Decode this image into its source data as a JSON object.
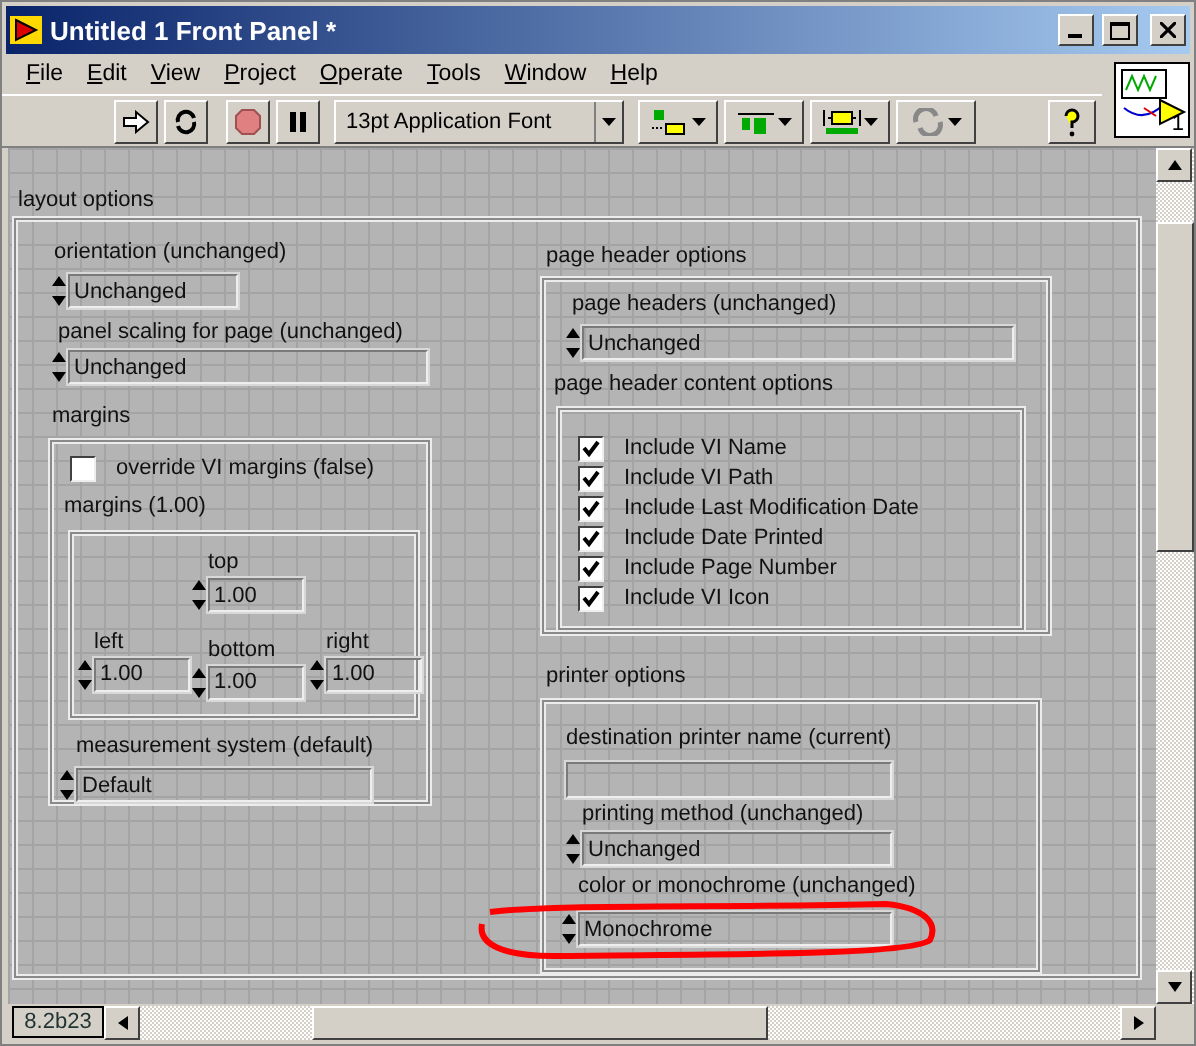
{
  "window": {
    "title": "Untitled 1 Front Panel *"
  },
  "menu": [
    "File",
    "Edit",
    "View",
    "Project",
    "Operate",
    "Tools",
    "Window",
    "Help"
  ],
  "toolbar": {
    "font": "13pt Application Font"
  },
  "vi_icon": {
    "number": "1"
  },
  "panel": {
    "label": "layout options",
    "orientation": {
      "label": "orientation (unchanged)",
      "value": "Unchanged"
    },
    "scaling": {
      "label": "panel scaling for page (unchanged)",
      "value": "Unchanged"
    },
    "margins": {
      "label": "margins",
      "override": {
        "label": "override VI margins (false)",
        "checked": false
      },
      "values_label": "margins (1.00)",
      "top": {
        "label": "top",
        "value": "1.00"
      },
      "left": {
        "label": "left",
        "value": "1.00"
      },
      "right": {
        "label": "right",
        "value": "1.00"
      },
      "bottom": {
        "label": "bottom",
        "value": "1.00"
      },
      "measurement": {
        "label": "measurement system (default)",
        "value": "Default"
      }
    },
    "page_header": {
      "label": "page header options",
      "headers": {
        "label": "page headers (unchanged)",
        "value": "Unchanged"
      },
      "content_label": "page header content options",
      "options": [
        {
          "label": "Include VI Name",
          "checked": true
        },
        {
          "label": "Include VI Path",
          "checked": true
        },
        {
          "label": "Include Last Modification Date",
          "checked": true
        },
        {
          "label": "Include Date Printed",
          "checked": true
        },
        {
          "label": "Include Page Number",
          "checked": true
        },
        {
          "label": "Include VI Icon",
          "checked": true
        }
      ]
    },
    "printer": {
      "label": "printer options",
      "destination": {
        "label": "destination printer name (current)"
      },
      "method": {
        "label": "printing method (unchanged)",
        "value": "Unchanged"
      },
      "color": {
        "label": "color or monochrome (unchanged)",
        "value": "Monochrome"
      }
    }
  },
  "status_bar": {
    "version": "8.2b23"
  }
}
